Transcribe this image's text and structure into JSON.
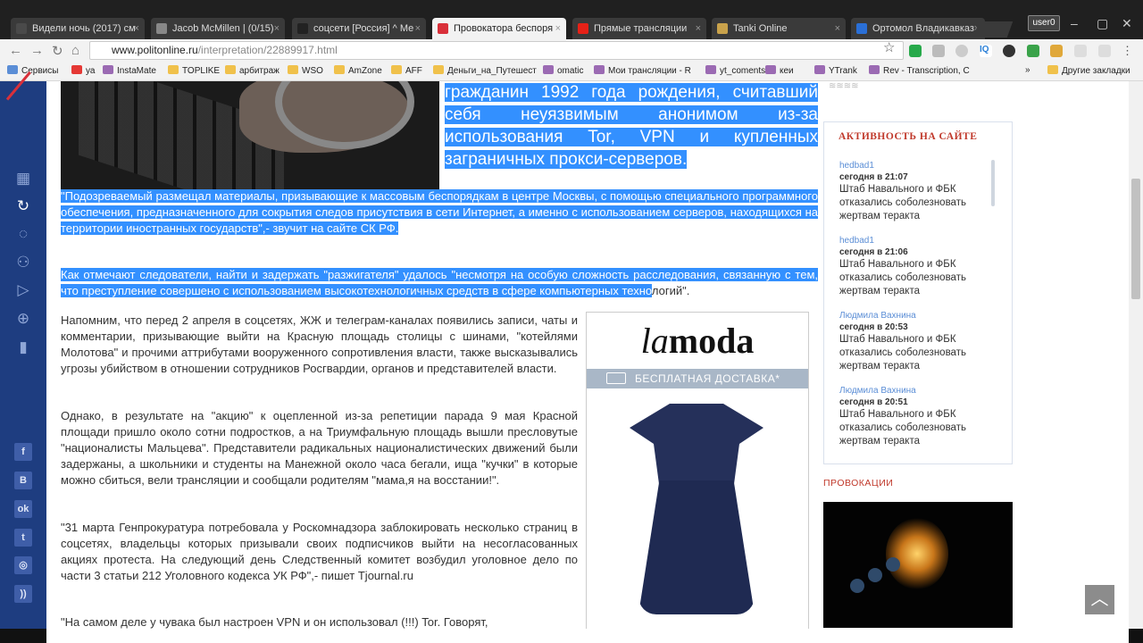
{
  "browser": {
    "tabs": [
      {
        "title": "Видели ночь (2017) см",
        "fav_color": "#4a4a4a"
      },
      {
        "title": "Jacob McMillen | (0/15)",
        "fav_color": "#888888"
      },
      {
        "title": "соцсети [Россия] ^ Ме",
        "fav_color": "#222222"
      },
      {
        "title": "Провокатора беспоря",
        "fav_color": "#d9303a"
      },
      {
        "title": "Прямые трансляции",
        "fav_color": "#e62117"
      },
      {
        "title": "Tanki Online",
        "fav_color": "#c9a24b"
      },
      {
        "title": "Ортомол Владикавказ",
        "fav_color": "#2a6fd6"
      }
    ],
    "active_tab_index": 3,
    "user_label": "user0",
    "url_host": "www.politonline.ru",
    "url_path": "/interpretation/22889917.html",
    "bookmarks": [
      {
        "label": "Сервисы",
        "type": "apps"
      },
      {
        "label": "уа",
        "type": "ya"
      },
      {
        "label": "InstaMate",
        "type": "site"
      },
      {
        "label": "TOPLIKE",
        "type": "folder"
      },
      {
        "label": "арбитраж",
        "type": "folder"
      },
      {
        "label": "WSO",
        "type": "folder"
      },
      {
        "label": "AmZone",
        "type": "folder"
      },
      {
        "label": "AFF",
        "type": "folder"
      },
      {
        "label": "Деньги_на_Путешест",
        "type": "folder"
      },
      {
        "label": "omatic",
        "type": "site"
      },
      {
        "label": "Мои трансляции - R",
        "type": "site"
      },
      {
        "label": "yt_coments",
        "type": "site"
      },
      {
        "label": "кеи",
        "type": "site"
      },
      {
        "label": "YTrank",
        "type": "site"
      },
      {
        "label": "Rev - Transcription, C",
        "type": "site"
      }
    ],
    "bookmarks_more": "»",
    "other_bookmarks": "Другие закладки"
  },
  "article": {
    "lead_text": "гражданин 1992 года рождения, считавший себя неуязвимым анонимом из-за использования Tor, VPN и купленных заграничных прокси-серверов.",
    "quote1": "\"Подозреваемый размещал материалы, призывающие к массовым беспорядкам в центре Москвы, с помощью специального программного обеспечения, предназначенного для сокрытия следов присутствия в сети Интернет, а именно с использованием серверов, находящихся на территории иностранных государств\",- звучит на сайте СК РФ.",
    "quote2_selected": "Как отмечают следователи, найти и задержать \"разжигателя\" удалось \"несмотря на особую сложность расследования, связанную с тем, что преступление совершено с использованием высокотехнологичных средств в сфере компьютерных техно",
    "quote2_rest": "логий\".",
    "para1": "Напомним, что перед 2 апреля в соцсетях, ЖЖ и телеграм-каналах появились записи, чаты и комментарии, призывающие выйти на Красную площадь столицы с шинами, \"котейлями Молотова\" и прочими аттрибутами вооруженного сопротивления власти, также высказывались угрозы убийством в отношении сотрудников Росгвардии, органов и представителей власти.",
    "para2": "Однако, в результате на \"акцию\" к оцепленной из-за репетиции парада 9 мая Красной площади пришло около сотни подростков, а на Триумфальную площадь вышли пресловутые \"националисты Мальцева\". Представители радикальных националистических движений были задержаны, а школьники и студенты на Манежной около часа бегали, ища \"кучки\" в которые можно сбиться, вели трансляции и сообщали родителям \"мама,я на восстании!\".",
    "para3": "\"31 марта Генпрокуратура потребовала у Роскомнадзора заблокировать несколько страниц в соцсетях, владельцы которых призывали своих подписчиков выйти на несогласованных акциях протеста. На следующий день Следственный комитет возбудил уголовное дело по части 3 статьи 212 Уголовного кодекса УК РФ\",- пишет Tjournal.ru",
    "para4": "\"На самом деле у чувака был настроен VPN и он использовал (!!!) Tor. Говорят,"
  },
  "ad": {
    "brand_la": "la",
    "brand_moda": "moda",
    "shipping": "БЕСПЛАТНАЯ ДОСТАВКА*"
  },
  "activity": {
    "title": "АКТИВНОСТЬ НА САЙТЕ",
    "items": [
      {
        "user": "hedbad1",
        "time": "сегодня в 21:07",
        "text": "Штаб Навального и ФБК отказались соболезновать жертвам теракта"
      },
      {
        "user": "hedbad1",
        "time": "сегодня в 21:06",
        "text": "Штаб Навального и ФБК отказались соболезновать жертвам теракта"
      },
      {
        "user": "Людмила Вахнина",
        "time": "сегодня в 20:53",
        "text": "Штаб Навального и ФБК отказались соболезновать жертвам теракта"
      },
      {
        "user": "Людмила Вахнина",
        "time": "сегодня в 20:51",
        "text": "Штаб Навального и ФБК отказались соболезновать жертвам теракта"
      }
    ]
  },
  "provocations_label": "ПРОВОКАЦИИ",
  "sidebar": {
    "nav_icons": [
      "grid-icon",
      "refresh-icon",
      "chat-icon",
      "user-icon",
      "play-icon",
      "target-icon",
      "stats-icon"
    ],
    "social": [
      {
        "name": "facebook-icon",
        "glyph": "f"
      },
      {
        "name": "vk-icon",
        "glyph": "B"
      },
      {
        "name": "odnoklassniki-icon",
        "glyph": "ok"
      },
      {
        "name": "twitter-icon",
        "glyph": "t"
      },
      {
        "name": "instagram-icon",
        "glyph": "◎"
      },
      {
        "name": "rss-icon",
        "glyph": "))"
      }
    ]
  },
  "colors": {
    "sidebar": "#1e3d80",
    "accent_red": "#c0392b",
    "selection": "#3390ff",
    "link": "#5b8ed6"
  }
}
